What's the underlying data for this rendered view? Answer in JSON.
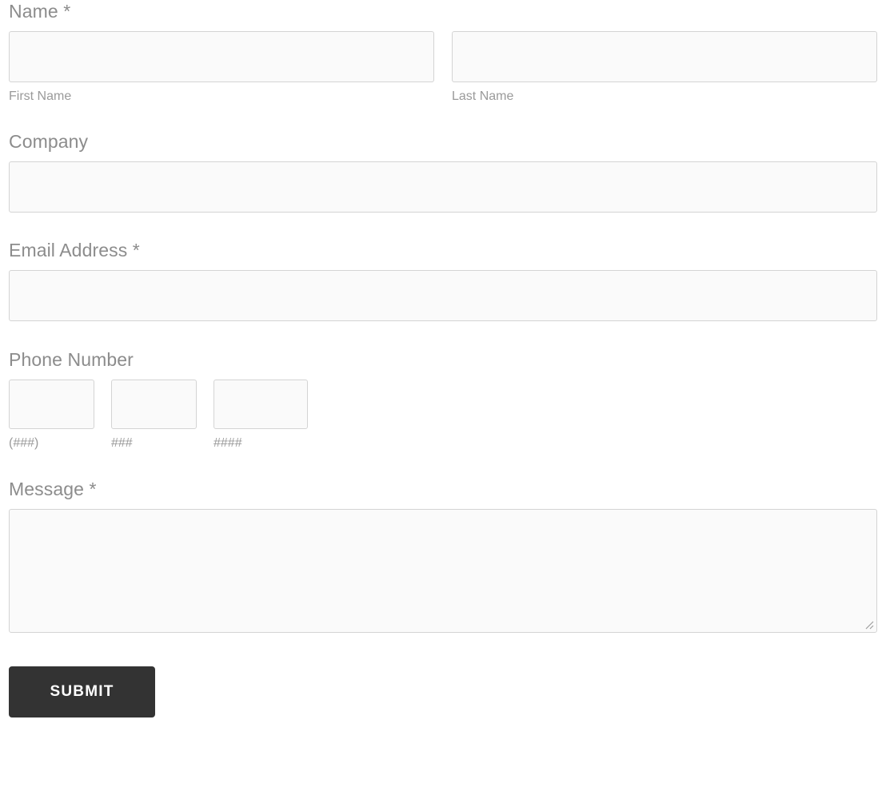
{
  "form": {
    "fields": [
      {
        "id": "name",
        "label": "Name *",
        "type": "split",
        "parts": [
          {
            "sub_label": "First Name",
            "value": "",
            "placeholder": ""
          },
          {
            "sub_label": "Last Name",
            "value": "",
            "placeholder": ""
          }
        ]
      },
      {
        "id": "company",
        "label": "Company",
        "type": "text",
        "value": "",
        "placeholder": ""
      },
      {
        "id": "email",
        "label": "Email Address *",
        "type": "email",
        "value": "",
        "placeholder": ""
      },
      {
        "id": "phone",
        "label": "Phone Number",
        "type": "phone",
        "parts": [
          {
            "sub_label": "(###)",
            "value": "",
            "placeholder": ""
          },
          {
            "sub_label": "###",
            "value": "",
            "placeholder": ""
          },
          {
            "sub_label": "####",
            "value": "",
            "placeholder": ""
          }
        ]
      },
      {
        "id": "message",
        "label": "Message *",
        "type": "textarea",
        "value": "",
        "placeholder": ""
      }
    ],
    "submit": {
      "label": "Submit"
    },
    "colors": {
      "page_background": "#ffffff",
      "input_background": "#fafafa",
      "input_border": "#d4d4d4",
      "label_text": "#8c8c8c",
      "sub_label_text": "#9a9a9a",
      "submit_background": "#333333",
      "submit_text": "#ffffff"
    },
    "icons": {
      "resize_grip": "resize-grip-icon"
    }
  }
}
